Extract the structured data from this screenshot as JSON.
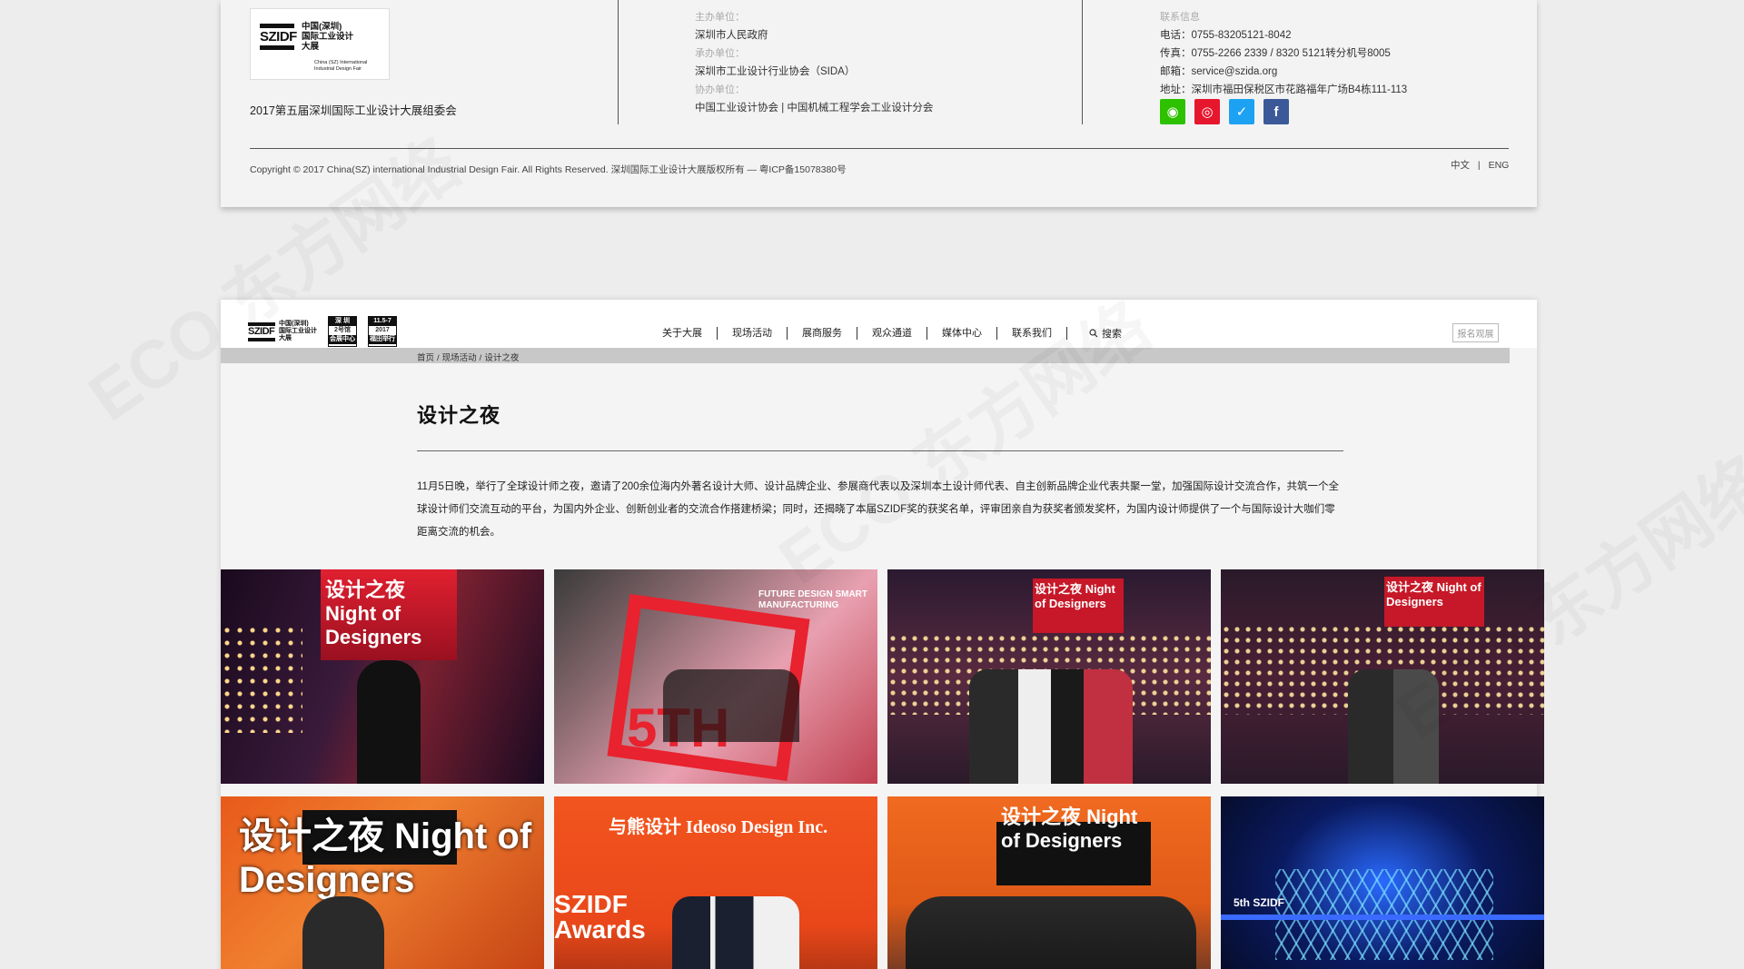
{
  "footer": {
    "logo": {
      "cn_line1": "中国(深圳)",
      "cn_line2": "国际工业设计",
      "cn_line3": "大展",
      "mark": "SZIDF",
      "en": "China (SZ) International Industrial Design Fair"
    },
    "org_name": "2017第五届深圳国际工业设计大展组委会",
    "host_label": "主办单位：",
    "host_value": "深圳市人民政府",
    "organizer_label": "承办单位：",
    "organizer_value": "深圳市工业设计行业协会（SIDA）",
    "coorg_label": "协办单位：",
    "coorg_value": "中国工业设计协会 | 中国机械工程学会工业设计分会",
    "contact_label": "联系信息",
    "phone": "电话：0755-83205121-8042",
    "fax": "传真：0755-2266 2339 / 8320 5121转分机号8005",
    "email": "邮箱：service@szida.org",
    "address": "地址：深圳市福田保税区市花路福年广场B4栋111-113",
    "social": [
      {
        "name": "wechat-icon",
        "glyph": "◉",
        "color": "#2dc100"
      },
      {
        "name": "weibo-icon",
        "glyph": "◎",
        "color": "#e6162d"
      },
      {
        "name": "twitter-icon",
        "glyph": "✓",
        "color": "#1da1f2"
      },
      {
        "name": "facebook-icon",
        "glyph": "f",
        "color": "#3b5998"
      }
    ],
    "copyright": "Copyright © 2017 China(SZ) international Industrial Design Fair. All Rights Reserved. 深圳国际工业设计大展版权所有 — 粤ICP备15078380号",
    "lang_cn": "中文",
    "lang_sep": "|",
    "lang_en": "ENG"
  },
  "nav": {
    "logo_badge1_line1": "深 圳",
    "logo_badge1_line2": "2号馆",
    "logo_badge1_line3": "会展中心",
    "logo_badge2_line1": "11.5-7",
    "logo_badge2_line2": "2017",
    "logo_badge2_line3": "福田举行",
    "items": [
      "关于大展",
      "现场活动",
      "展商服务",
      "观众通道",
      "媒体中心",
      "联系我们"
    ],
    "search_label": "搜索",
    "register_button": "报名观展"
  },
  "breadcrumb": {
    "home": "首页",
    "sep": "/",
    "level1": "现场活动",
    "current": "设计之夜"
  },
  "article": {
    "title": "设计之夜",
    "body": "11月5日晚，举行了全球设计师之夜，邀请了200余位海内外著名设计大师、设计品牌企业、参展商代表以及深圳本土设计师代表、自主创新品牌企业代表共聚一堂，加强国际设计交流合作，共筑一个全球设计师们交流互动的平台，为国内外企业、创新创业者的交流合作搭建桥梁；同时，还揭晓了本届SZIDF奖的获奖名单，评审团亲自为获奖者颁发奖杯，为国内设计师提供了一个与国际设计大咖们零距离交流的机会。"
  },
  "gallery": {
    "photos": [
      {
        "name": "photo-night-of-designers-speaker",
        "caption": "设计之夜 Night of Designers"
      },
      {
        "name": "photo-5th-szidf-group",
        "caption": "FUTURE DESIGN SMART MANUFACTURING"
      },
      {
        "name": "photo-szidf-wall-group",
        "caption": "设计之夜 Night of Designers"
      },
      {
        "name": "photo-szidf-wall-pair",
        "caption": "设计之夜 Night of Designers"
      },
      {
        "name": "photo-night-of-designers-closeup",
        "caption": "设计之夜 Night of Designers"
      },
      {
        "name": "photo-ideoso-award",
        "caption": "与熊设计 Ideoso Design Inc."
      },
      {
        "name": "photo-award-winners-group",
        "caption": "设计之夜 Night of Designers"
      },
      {
        "name": "photo-stage-light-show",
        "caption": "5th SZIDF"
      }
    ]
  },
  "watermark": "ECO 东方网络"
}
